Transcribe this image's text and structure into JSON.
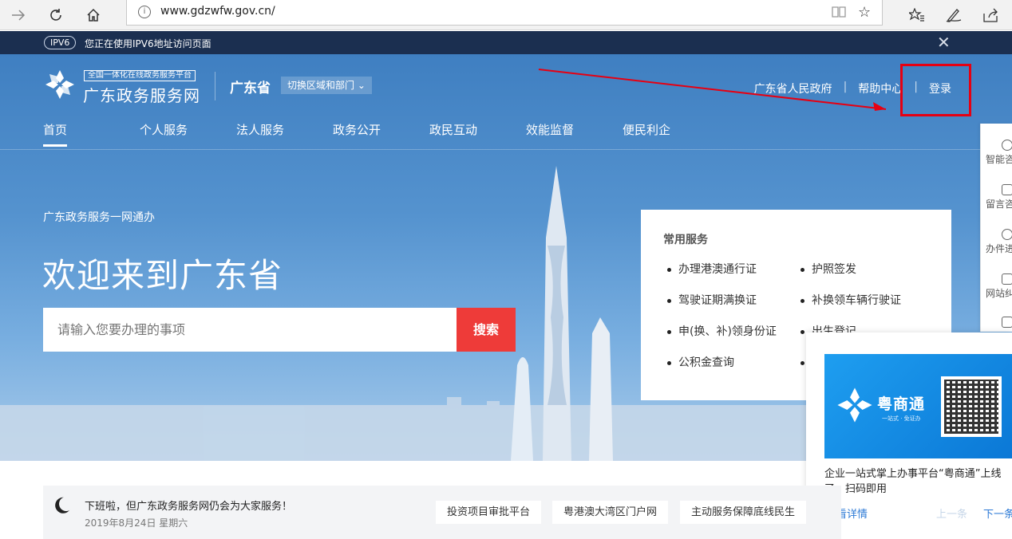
{
  "browser": {
    "url": "www.gdzwfw.gov.cn/",
    "info_icon": "i"
  },
  "ipv6": {
    "tag": "IPV6",
    "message": "您正在使用IPV6地址访问页面",
    "close": "✕"
  },
  "header": {
    "logo_sub": "全国一体化在线政务服务平台",
    "logo_title": "广东政务服务网",
    "region": "广东省",
    "switch_label": "切换区域和部门 ⌄",
    "links": [
      "广东省人民政府",
      "帮助中心",
      "登录"
    ]
  },
  "nav": [
    "首页",
    "个人服务",
    "法人服务",
    "政务公开",
    "政民互动",
    "效能监督",
    "便民利企"
  ],
  "hero": {
    "slogan": "广东政务服务一网通办",
    "welcome": "欢迎来到广东省",
    "search_placeholder": "请输入您要办理的事项",
    "search_button": "搜索"
  },
  "services": {
    "title": "常用服务",
    "items": [
      "办理港澳通行证",
      "护照签发",
      "驾驶证期满换证",
      "补换领车辆行驶证",
      "申(换、补)领身份证",
      "出生登记",
      "公积金查询",
      ""
    ]
  },
  "sidebar": [
    "智能咨",
    "留言咨",
    "办件进",
    "网站纠"
  ],
  "popup": {
    "brand": "粤商通",
    "brand_tag": "一站式 · 免证办",
    "desc": "企业一站式掌上办事平台“粤商通”上线了，扫码即用",
    "more": "查看详情",
    "prev": "上一条",
    "next": "下一条"
  },
  "notice": {
    "text": "下班啦，但广东政务服务网仍会为大家服务！",
    "date": "2019年8月24日 星期六",
    "buttons": [
      "投资项目审批平台",
      "粤港澳大湾区门户网",
      "主动服务保障底线民生"
    ]
  },
  "colors": {
    "accent_red": "#ee3b39",
    "hero_blue": "#3f7fc1",
    "ipv6_bar": "#1b2f50",
    "annotation_red": "#e60012"
  }
}
